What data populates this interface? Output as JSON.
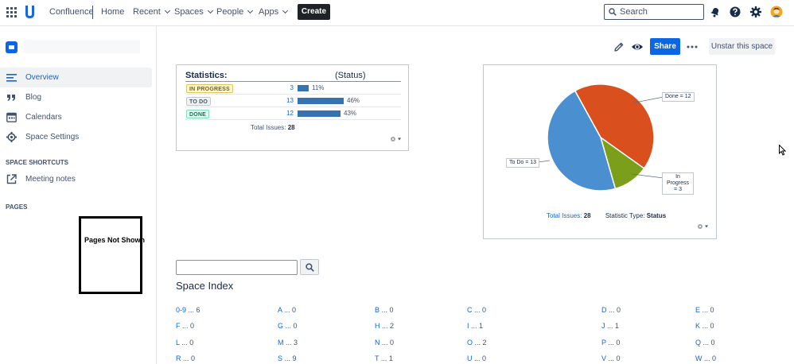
{
  "topnav": {
    "product": "Confluence",
    "items": [
      {
        "label": "Home"
      },
      {
        "label": "Recent"
      },
      {
        "label": "Spaces"
      },
      {
        "label": "People"
      },
      {
        "label": "Apps"
      }
    ],
    "create_label": "Create",
    "search_placeholder": "Search",
    "icons": [
      "app-switcher-icon",
      "confluence-logo-icon",
      "notifications-icon",
      "help-icon",
      "settings-icon",
      "user-avatar-icon"
    ]
  },
  "sidebar": {
    "items": [
      {
        "label": "Overview",
        "icon": "overview-icon",
        "active": true
      },
      {
        "label": "Blog",
        "icon": "quote-icon"
      },
      {
        "label": "Calendars",
        "icon": "calendar-icon"
      },
      {
        "label": "Space Settings",
        "icon": "gear-icon"
      }
    ],
    "shortcuts_heading": "SPACE SHORTCUTS",
    "shortcuts": [
      {
        "label": "Meeting notes",
        "icon": "external-link-icon"
      }
    ],
    "pages_heading": "PAGES",
    "pages_placeholder": "Pages Not Shown"
  },
  "toolbar": {
    "share_label": "Share",
    "unstar_label": "Unstar this space",
    "icons": [
      "edit-icon",
      "watch-icon",
      "more-icon"
    ]
  },
  "statistics": {
    "title": "Statistics:",
    "subtitle": "(Status)",
    "rows": [
      {
        "status": "IN PROGRESS",
        "count": "3",
        "percent": "11%",
        "fraction": 0.11,
        "bg": "#fff7d6",
        "fg": "#7f5f01",
        "border": "#e2c45b"
      },
      {
        "status": "TO DO",
        "count": "13",
        "percent": "46%",
        "fraction": 0.46,
        "bg": "#f1f2f4",
        "fg": "#42526e",
        "border": "#c1c7d0"
      },
      {
        "status": "DONE",
        "count": "12",
        "percent": "43%",
        "fraction": 0.43,
        "bg": "#dcfff1",
        "fg": "#216e4e",
        "border": "#7ee2b8"
      }
    ],
    "total_label": "Total Issues:",
    "total_value": "28"
  },
  "chart_data": {
    "type": "pie",
    "slices": [
      {
        "label": "Done = 12",
        "value": 12,
        "color": "#d94f1e"
      },
      {
        "label": "In Progress = 3",
        "value": 3,
        "color": "#7b9f1a"
      },
      {
        "label": "To Do = 13",
        "value": 13,
        "color": "#4a8fcf"
      }
    ],
    "total_label": "Total Issues:",
    "total_value": "28",
    "stat_type_label": "Statistic Type:",
    "stat_type_value": "Status"
  },
  "space_index": {
    "title": "Space Index",
    "entries": [
      {
        "letter": "0-9",
        "count": "6"
      },
      {
        "letter": "A",
        "count": "0"
      },
      {
        "letter": "B",
        "count": "0"
      },
      {
        "letter": "C",
        "count": "0"
      },
      {
        "letter": "D",
        "count": "0"
      },
      {
        "letter": "E",
        "count": "0"
      },
      {
        "letter": "F",
        "count": "0"
      },
      {
        "letter": "G",
        "count": "0"
      },
      {
        "letter": "H",
        "count": "2"
      },
      {
        "letter": "I",
        "count": "1"
      },
      {
        "letter": "J",
        "count": "1"
      },
      {
        "letter": "K",
        "count": "0"
      },
      {
        "letter": "L",
        "count": "0"
      },
      {
        "letter": "M",
        "count": "3"
      },
      {
        "letter": "N",
        "count": "0"
      },
      {
        "letter": "O",
        "count": "2"
      },
      {
        "letter": "P",
        "count": "0"
      },
      {
        "letter": "Q",
        "count": "0"
      },
      {
        "letter": "R",
        "count": "0"
      },
      {
        "letter": "S",
        "count": "9"
      },
      {
        "letter": "T",
        "count": "1"
      },
      {
        "letter": "U",
        "count": "0"
      },
      {
        "letter": "V",
        "count": "0"
      },
      {
        "letter": "W",
        "count": "0"
      }
    ]
  }
}
